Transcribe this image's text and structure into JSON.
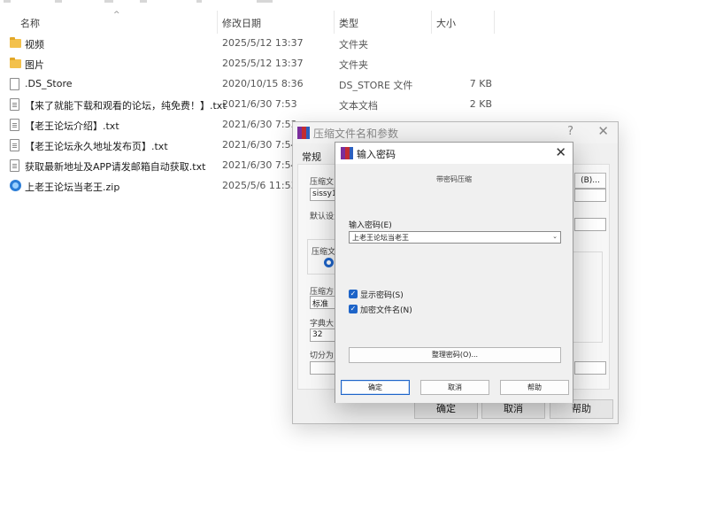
{
  "explorer": {
    "columns": {
      "name": "名称",
      "date": "修改日期",
      "type": "类型",
      "size": "大小"
    },
    "sort_indicator": "^",
    "files": [
      {
        "icon": "folder-icon",
        "name": "视频",
        "date": "2025/5/12 13:37",
        "type": "文件夹",
        "size": ""
      },
      {
        "icon": "folder-icon",
        "name": "图片",
        "date": "2025/5/12 13:37",
        "type": "文件夹",
        "size": ""
      },
      {
        "icon": "file-icon",
        "name": ".DS_Store",
        "date": "2020/10/15 8:36",
        "type": "DS_STORE 文件",
        "size": "7 KB"
      },
      {
        "icon": "text-file-icon",
        "name": "【来了就能下载和观看的论坛，纯免费！】.txt",
        "date": "2021/6/30 7:53",
        "type": "文本文档",
        "size": "2 KB"
      },
      {
        "icon": "text-file-icon",
        "name": "【老王论坛介绍】.txt",
        "date": "2021/6/30 7:53",
        "type": "",
        "size": ""
      },
      {
        "icon": "text-file-icon",
        "name": "【老王论坛永久地址发布页】.txt",
        "date": "2021/6/30 7:54",
        "type": "",
        "size": ""
      },
      {
        "icon": "text-file-icon",
        "name": "获取最新地址及APP请发邮箱自动获取.txt",
        "date": "2021/6/30 7:54",
        "type": "",
        "size": ""
      },
      {
        "icon": "zip-icon",
        "name": "上老王论坛当老王.zip",
        "date": "2025/5/6 11:53",
        "type": "",
        "size": ""
      }
    ]
  },
  "archive_dialog": {
    "title": "压缩文件名和参数",
    "help_glyph": "?",
    "close_glyph": "✕",
    "tab_general": "常规",
    "archive_name_label": "压缩文",
    "archive_name_value": "sissy1.r",
    "browse_button": "(B)...",
    "default_settings_label": "默认设置",
    "format_label": "压缩文",
    "method_label": "压缩方",
    "method_value": "标准",
    "dict_label": "字典大",
    "dict_value": "32",
    "split_label": "切分为",
    "ok": "确定",
    "cancel": "取消",
    "help": "帮助"
  },
  "password_dialog": {
    "title": "输入密码",
    "close_glyph": "✕",
    "caption": "带密码压缩",
    "password_label": "输入密码(E)",
    "password_value": "上老王论坛当老王",
    "combo_arrow": "⌄",
    "show_password_label": "显示密码(S)",
    "show_password_checked": true,
    "encrypt_names_label": "加密文件名(N)",
    "encrypt_names_checked": true,
    "organize_button": "整理密码(O)...",
    "ok": "确定",
    "cancel": "取消",
    "help": "帮助"
  }
}
